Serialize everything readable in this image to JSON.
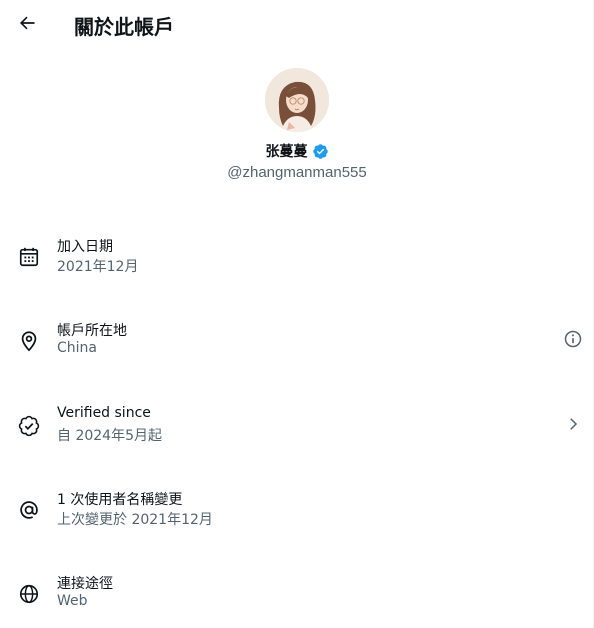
{
  "header": {
    "back_icon": "arrow-left-icon",
    "title": "關於此帳戶"
  },
  "profile": {
    "display_name": "张蔓蔓",
    "verified_badge": "verified-badge-icon",
    "badge_color": "#1d9bf0",
    "handle": "@zhangmanman555"
  },
  "items": [
    {
      "icon": "calendar-icon",
      "label": "加入日期",
      "value": "2021年12月"
    },
    {
      "icon": "location-pin-icon",
      "label": "帳戶所在地",
      "value": "China",
      "right_icon": "info-icon"
    },
    {
      "icon": "verified-check-icon",
      "label": "Verified since",
      "value": "自 2024年5月起",
      "right_icon": "chevron-right-icon"
    },
    {
      "icon": "at-sign-icon",
      "label": "1 次使用者名稱變更",
      "value": "上次變更於 2021年12月"
    },
    {
      "icon": "globe-icon",
      "label": "連接途徑",
      "value": "Web"
    }
  ],
  "colors": {
    "text_primary": "#0f1419",
    "text_secondary": "#536471"
  }
}
